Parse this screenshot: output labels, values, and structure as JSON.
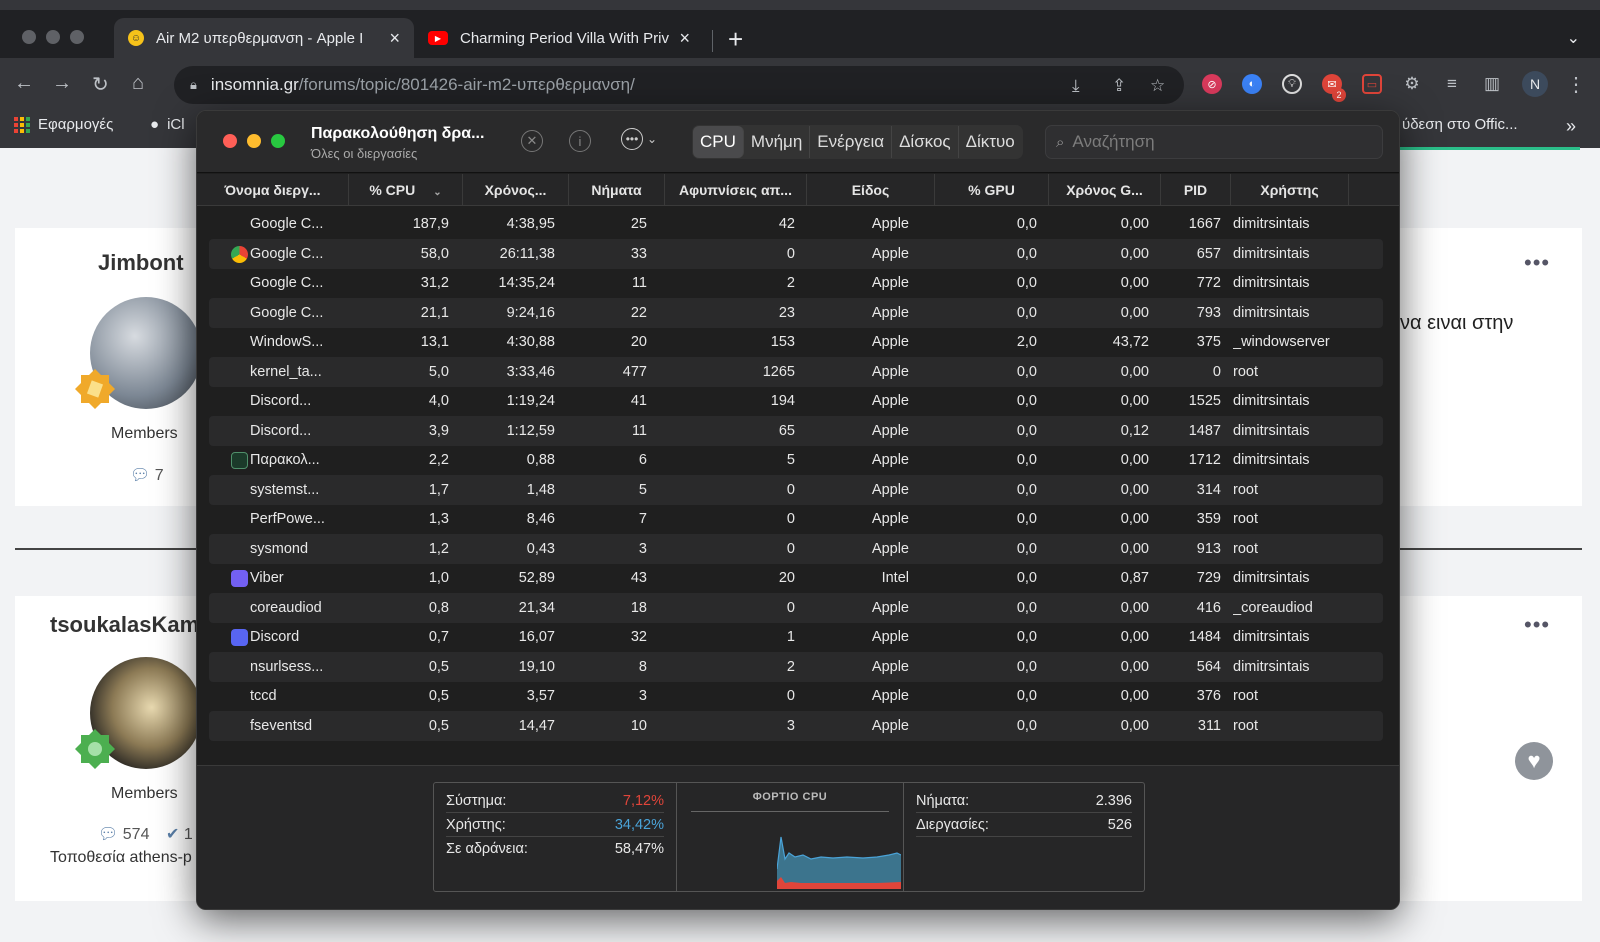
{
  "browser": {
    "tabs": [
      {
        "title": "Air M2 υπερθερμανση - Apple I",
        "active": true
      },
      {
        "title": "Charming Period Villa With Priv",
        "active": false
      }
    ],
    "url_host": "insomnia.gr",
    "url_path": "/forums/topic/801426-air-m2-υπερθερμανση/",
    "extension_badge": "2",
    "profile_initial": "N",
    "bookmarks": {
      "apps": "Εφαρμογές",
      "icloud": "iCl",
      "office": "ύδεση στο Offic..."
    }
  },
  "forum": {
    "posts": [
      {
        "username": "Jimbont",
        "rank": "Members",
        "post_count": "7",
        "snippet": "να ειναι στην"
      },
      {
        "username": "tsoukalasKam",
        "rank": "Members",
        "post_count": "574",
        "reputation": "1",
        "location": "Τοποθεσία athens-p"
      }
    ]
  },
  "activity_monitor": {
    "title": "Παρακολούθηση δρα...",
    "subtitle": "Όλες οι διεργασίες",
    "tabs": [
      "CPU",
      "Μνήμη",
      "Ενέργεια",
      "Δίσκος",
      "Δίκτυο"
    ],
    "active_tab": "CPU",
    "search_placeholder": "Αναζήτηση",
    "columns": [
      "Όνομα διεργ...",
      "% CPU",
      "Χρόνος...",
      "Νήματα",
      "Αφυπνίσεις απ...",
      "Είδος",
      "% GPU",
      "Χρόνος G...",
      "PID",
      "Χρήστης"
    ],
    "rows": [
      {
        "name": "Google C...",
        "icon": "none",
        "cpu": "187,9",
        "time": "4:38,95",
        "threads": "25",
        "wakeups": "42",
        "kind": "Apple",
        "gpu": "0,0",
        "gpu_time": "0,00",
        "pid": "1667",
        "user": "dimitrsintais"
      },
      {
        "name": "Google C...",
        "icon": "chrome",
        "cpu": "58,0",
        "time": "26:11,38",
        "threads": "33",
        "wakeups": "0",
        "kind": "Apple",
        "gpu": "0,0",
        "gpu_time": "0,00",
        "pid": "657",
        "user": "dimitrsintais"
      },
      {
        "name": "Google C...",
        "icon": "none",
        "cpu": "31,2",
        "time": "14:35,24",
        "threads": "11",
        "wakeups": "2",
        "kind": "Apple",
        "gpu": "0,0",
        "gpu_time": "0,00",
        "pid": "772",
        "user": "dimitrsintais"
      },
      {
        "name": "Google C...",
        "icon": "none",
        "cpu": "21,1",
        "time": "9:24,16",
        "threads": "22",
        "wakeups": "23",
        "kind": "Apple",
        "gpu": "0,0",
        "gpu_time": "0,00",
        "pid": "793",
        "user": "dimitrsintais"
      },
      {
        "name": "WindowS...",
        "icon": "none",
        "cpu": "13,1",
        "time": "4:30,88",
        "threads": "20",
        "wakeups": "153",
        "kind": "Apple",
        "gpu": "2,0",
        "gpu_time": "43,72",
        "pid": "375",
        "user": "_windowserver"
      },
      {
        "name": "kernel_ta...",
        "icon": "none",
        "cpu": "5,0",
        "time": "3:33,46",
        "threads": "477",
        "wakeups": "1265",
        "kind": "Apple",
        "gpu": "0,0",
        "gpu_time": "0,00",
        "pid": "0",
        "user": "root"
      },
      {
        "name": "Discord...",
        "icon": "none",
        "cpu": "4,0",
        "time": "1:19,24",
        "threads": "41",
        "wakeups": "194",
        "kind": "Apple",
        "gpu": "0,0",
        "gpu_time": "0,00",
        "pid": "1525",
        "user": "dimitrsintais"
      },
      {
        "name": "Discord...",
        "icon": "none",
        "cpu": "3,9",
        "time": "1:12,59",
        "threads": "11",
        "wakeups": "65",
        "kind": "Apple",
        "gpu": "0,0",
        "gpu_time": "0,12",
        "pid": "1487",
        "user": "dimitrsintais"
      },
      {
        "name": "Παρακολ...",
        "icon": "activity",
        "cpu": "2,2",
        "time": "0,88",
        "threads": "6",
        "wakeups": "5",
        "kind": "Apple",
        "gpu": "0,0",
        "gpu_time": "0,00",
        "pid": "1712",
        "user": "dimitrsintais"
      },
      {
        "name": "systemst...",
        "icon": "none",
        "cpu": "1,7",
        "time": "1,48",
        "threads": "5",
        "wakeups": "0",
        "kind": "Apple",
        "gpu": "0,0",
        "gpu_time": "0,00",
        "pid": "314",
        "user": "root"
      },
      {
        "name": "PerfPowe...",
        "icon": "none",
        "cpu": "1,3",
        "time": "8,46",
        "threads": "7",
        "wakeups": "0",
        "kind": "Apple",
        "gpu": "0,0",
        "gpu_time": "0,00",
        "pid": "359",
        "user": "root"
      },
      {
        "name": "sysmond",
        "icon": "none",
        "cpu": "1,2",
        "time": "0,43",
        "threads": "3",
        "wakeups": "0",
        "kind": "Apple",
        "gpu": "0,0",
        "gpu_time": "0,00",
        "pid": "913",
        "user": "root"
      },
      {
        "name": "Viber",
        "icon": "viber",
        "cpu": "1,0",
        "time": "52,89",
        "threads": "43",
        "wakeups": "20",
        "kind": "Intel",
        "gpu": "0,0",
        "gpu_time": "0,87",
        "pid": "729",
        "user": "dimitrsintais"
      },
      {
        "name": "coreaudiod",
        "icon": "none",
        "cpu": "0,8",
        "time": "21,34",
        "threads": "18",
        "wakeups": "0",
        "kind": "Apple",
        "gpu": "0,0",
        "gpu_time": "0,00",
        "pid": "416",
        "user": "_coreaudiod"
      },
      {
        "name": "Discord",
        "icon": "discord",
        "cpu": "0,7",
        "time": "16,07",
        "threads": "32",
        "wakeups": "1",
        "kind": "Apple",
        "gpu": "0,0",
        "gpu_time": "0,00",
        "pid": "1484",
        "user": "dimitrsintais"
      },
      {
        "name": "nsurlsess...",
        "icon": "none",
        "cpu": "0,5",
        "time": "19,10",
        "threads": "8",
        "wakeups": "2",
        "kind": "Apple",
        "gpu": "0,0",
        "gpu_time": "0,00",
        "pid": "564",
        "user": "dimitrsintais"
      },
      {
        "name": "tccd",
        "icon": "none",
        "cpu": "0,5",
        "time": "3,57",
        "threads": "3",
        "wakeups": "0",
        "kind": "Apple",
        "gpu": "0,0",
        "gpu_time": "0,00",
        "pid": "376",
        "user": "root"
      },
      {
        "name": "fseventsd",
        "icon": "none",
        "cpu": "0,5",
        "time": "14,47",
        "threads": "10",
        "wakeups": "3",
        "kind": "Apple",
        "gpu": "0,0",
        "gpu_time": "0,00",
        "pid": "311",
        "user": "root"
      }
    ],
    "summary": {
      "system_label": "Σύστημα:",
      "system_value": "7,12%",
      "user_label": "Χρήστης:",
      "user_value": "34,42%",
      "idle_label": "Σε αδράνεια:",
      "idle_value": "58,47%",
      "chart_title": "ΦΟΡΤΙΟ CPU",
      "threads_label": "Νήματα:",
      "threads_value": "2.396",
      "processes_label": "Διεργασίες:",
      "processes_value": "526"
    },
    "colors": {
      "system": "#e0453a",
      "user": "#4aa3d8",
      "user_fill": "#3f7d99"
    }
  }
}
